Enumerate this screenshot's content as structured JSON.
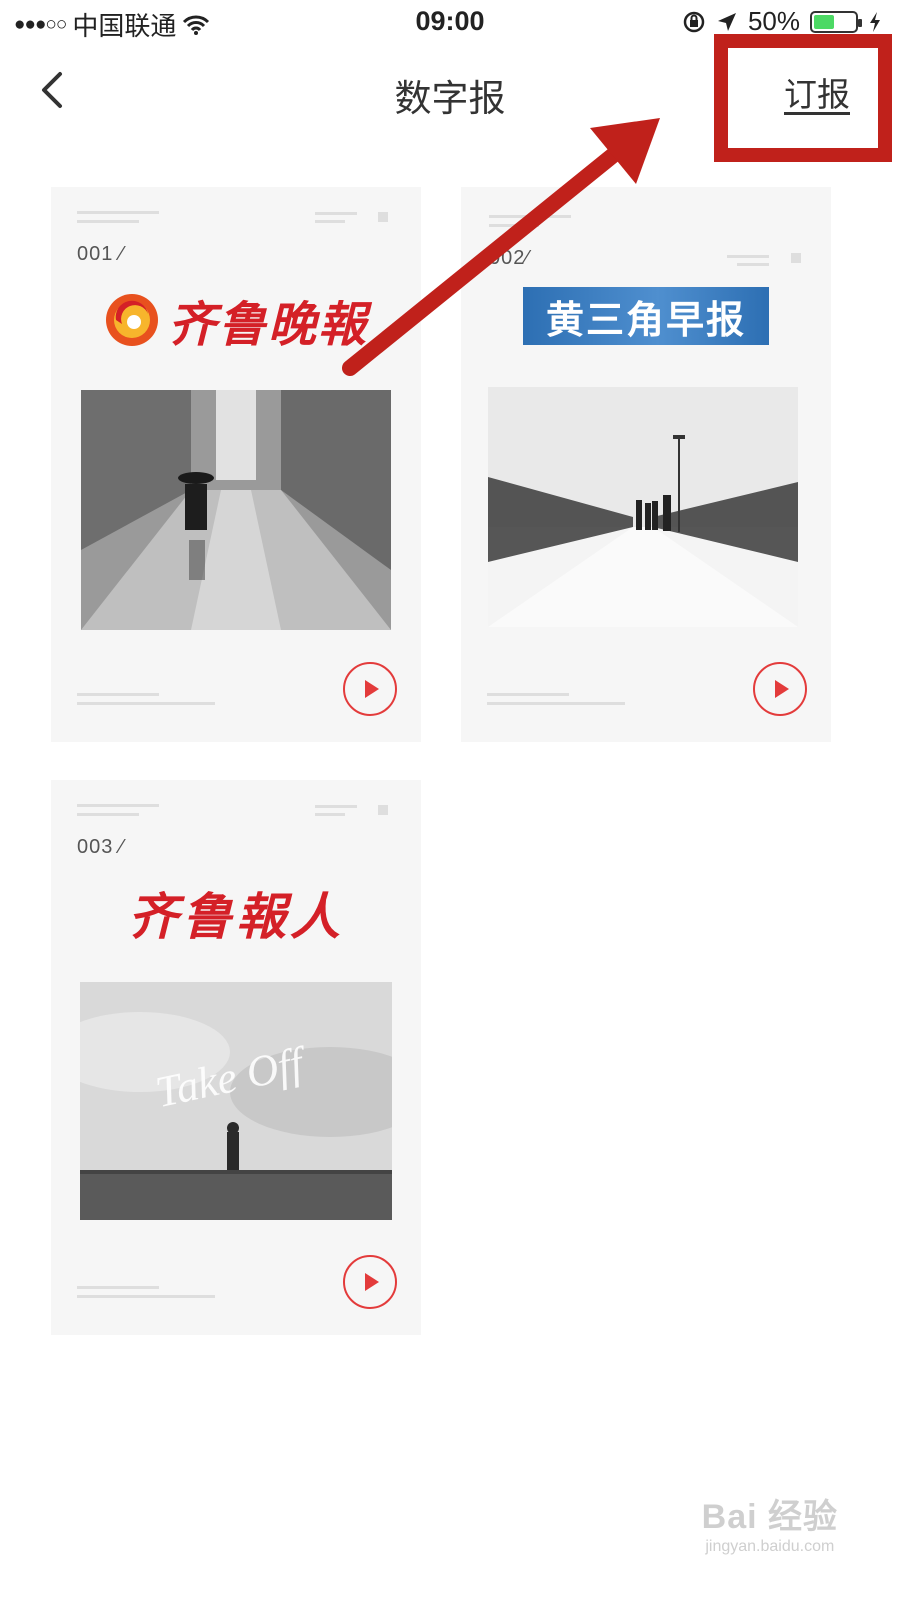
{
  "status_bar": {
    "signal": "●●●○○",
    "carrier": "中国联通",
    "time": "09:00",
    "battery": "50%",
    "battery_level": 0.5
  },
  "nav": {
    "title": "数字报",
    "subscribe_label": "订报"
  },
  "papers": [
    {
      "number": "001 ⁄",
      "name": "齐鲁晚報"
    },
    {
      "number": "002⁄",
      "name": "黄三角早报"
    },
    {
      "number": "003 ⁄",
      "name": "齐鲁報人",
      "photo_caption": "Take Off"
    }
  ],
  "colors": {
    "accent_red": "#e33b3b",
    "annotation_red": "#c0211b",
    "card_bg": "#f6f6f6",
    "battery_green": "#4cd964"
  },
  "watermark": {
    "brand": "Bai 经验",
    "url": "jingyan.baidu.com"
  }
}
